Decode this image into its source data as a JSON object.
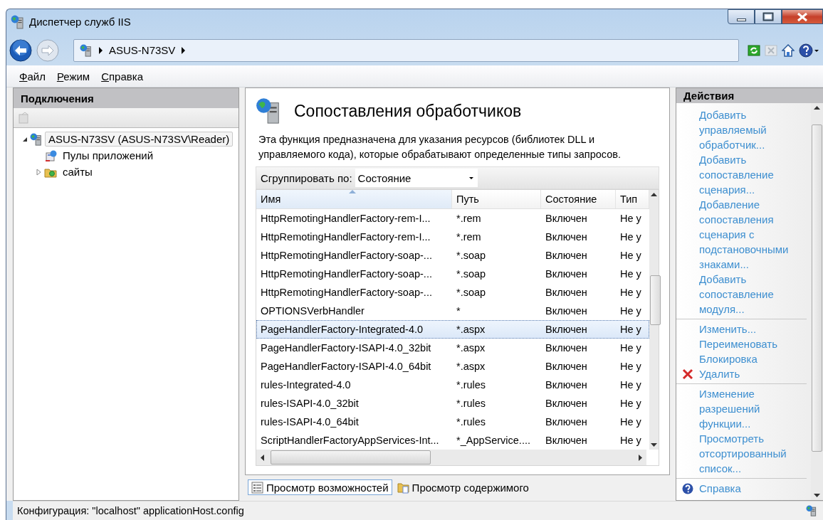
{
  "window": {
    "title": "Диспетчер служб IIS"
  },
  "address": {
    "crumbs": [
      "ASUS-N73SV"
    ]
  },
  "menu": [
    {
      "label": "Файл"
    },
    {
      "label": "Режим"
    },
    {
      "label": "Справка"
    }
  ],
  "connections": {
    "title": "Подключения",
    "tree": [
      {
        "label": "ASUS-N73SV (ASUS-N73SV\\Reader)",
        "kind": "server",
        "expanded": true,
        "selected": true,
        "children": [
          {
            "label": "Пулы приложений",
            "kind": "pools",
            "selected": false
          },
          {
            "label": "сайты",
            "kind": "sites",
            "expanded": false,
            "selected": false
          }
        ]
      }
    ]
  },
  "content": {
    "title": "Сопоставления обработчиков",
    "description": "Эта функция предназначена для указания ресурсов (библиотек DLL и управляемого кода), которые обрабатывают определенные типы запросов.",
    "group_by": {
      "label": "Сгруппировать по:",
      "value": "Состояние"
    },
    "table": {
      "columns": [
        {
          "label": "Имя",
          "sorted": true
        },
        {
          "label": "Путь",
          "sorted": false
        },
        {
          "label": "Состояние",
          "sorted": false
        },
        {
          "label": "Тип",
          "sorted": false
        }
      ],
      "rows": [
        {
          "cells": [
            "HttpRemotingHandlerFactory-rem-I...",
            "*.rem",
            "Включен",
            "Не у"
          ],
          "selected": false
        },
        {
          "cells": [
            "HttpRemotingHandlerFactory-rem-I...",
            "*.rem",
            "Включен",
            "Не у"
          ],
          "selected": false
        },
        {
          "cells": [
            "HttpRemotingHandlerFactory-soap-...",
            "*.soap",
            "Включен",
            "Не у"
          ],
          "selected": false
        },
        {
          "cells": [
            "HttpRemotingHandlerFactory-soap-...",
            "*.soap",
            "Включен",
            "Не у"
          ],
          "selected": false
        },
        {
          "cells": [
            "HttpRemotingHandlerFactory-soap-...",
            "*.soap",
            "Включен",
            "Не у"
          ],
          "selected": false
        },
        {
          "cells": [
            "OPTIONSVerbHandler",
            "*",
            "Включен",
            "Не у"
          ],
          "selected": false
        },
        {
          "cells": [
            "PageHandlerFactory-Integrated-4.0",
            "*.aspx",
            "Включен",
            "Не у"
          ],
          "selected": true
        },
        {
          "cells": [
            "PageHandlerFactory-ISAPI-4.0_32bit",
            "*.aspx",
            "Включен",
            "Не у"
          ],
          "selected": false
        },
        {
          "cells": [
            "PageHandlerFactory-ISAPI-4.0_64bit",
            "*.aspx",
            "Включен",
            "Не у"
          ],
          "selected": false
        },
        {
          "cells": [
            "rules-Integrated-4.0",
            "*.rules",
            "Включен",
            "Не у"
          ],
          "selected": false
        },
        {
          "cells": [
            "rules-ISAPI-4.0_32bit",
            "*.rules",
            "Включен",
            "Не у"
          ],
          "selected": false
        },
        {
          "cells": [
            "rules-ISAPI-4.0_64bit",
            "*.rules",
            "Включен",
            "Не у"
          ],
          "selected": false
        },
        {
          "cells": [
            "ScriptHandlerFactoryAppServices-Int...",
            "*_AppService....",
            "Включен",
            "Не у"
          ],
          "selected": false
        }
      ]
    },
    "view_tabs": [
      {
        "label": "Просмотр возможностей",
        "kind": "features",
        "selected": true
      },
      {
        "label": "Просмотр содержимого",
        "kind": "content",
        "selected": false
      }
    ]
  },
  "actions": {
    "title": "Действия",
    "groups": [
      {
        "items": [
          {
            "label": "Добавить управляемый обработчик...",
            "kind": "link"
          },
          {
            "label": "Добавить сопоставление сценария...",
            "kind": "link"
          },
          {
            "label": "Добавление сопоставления сценария с подстановочными знаками...",
            "kind": "link"
          },
          {
            "label": "Добавить сопоставление модуля...",
            "kind": "link"
          }
        ]
      },
      {
        "items": [
          {
            "label": "Изменить...",
            "kind": "link"
          },
          {
            "label": "Переименовать",
            "kind": "link"
          },
          {
            "label": "Блокировка",
            "kind": "link"
          },
          {
            "label": "Удалить",
            "kind": "delete"
          }
        ]
      },
      {
        "items": [
          {
            "label": "Изменение разрешений функции...",
            "kind": "link"
          },
          {
            "label": "Просмотреть отсортированный список...",
            "kind": "link"
          }
        ]
      },
      {
        "items": [
          {
            "label": "Справка",
            "kind": "help"
          }
        ]
      }
    ]
  },
  "status_bar": {
    "text": "Конфигурация: \"localhost\" applicationHost.config"
  }
}
